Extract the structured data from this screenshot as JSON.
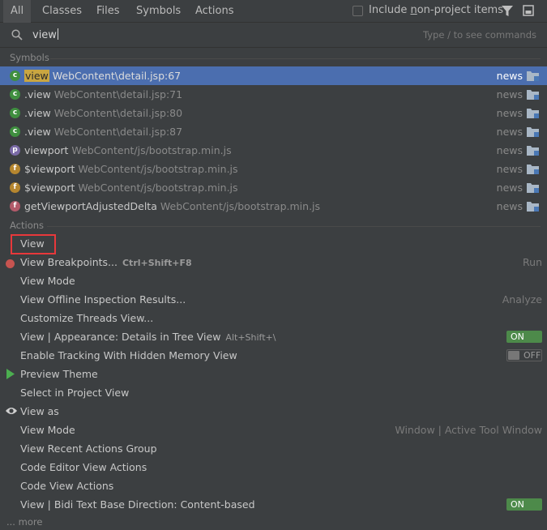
{
  "tabs": [
    "All",
    "Classes",
    "Files",
    "Symbols",
    "Actions"
  ],
  "include_non_project": {
    "label": "Include non-project items",
    "checked": false
  },
  "search": {
    "value": "view",
    "hint": "Type / to see commands"
  },
  "sections": {
    "symbols": "Symbols",
    "actions": "Actions"
  },
  "symbols": [
    {
      "icon": "c",
      "name_prefix": "",
      "name_match": "view",
      "name_suffix": "",
      "path": "WebContent\\detail.jsp:67",
      "location": "news",
      "selected": true
    },
    {
      "icon": "c",
      "name_prefix": "",
      "name_match": ".view",
      "name_suffix": "",
      "path": "WebContent\\detail.jsp:71",
      "location": "news",
      "selected": false
    },
    {
      "icon": "c",
      "name_prefix": "",
      "name_match": ".view",
      "name_suffix": "",
      "path": "WebContent\\detail.jsp:80",
      "location": "news",
      "selected": false
    },
    {
      "icon": "c",
      "name_prefix": "",
      "name_match": ".view",
      "name_suffix": "",
      "path": "WebContent\\detail.jsp:87",
      "location": "news",
      "selected": false
    },
    {
      "icon": "p",
      "name_prefix": "",
      "name_match": "viewport",
      "name_suffix": "",
      "path": "WebContent/js/bootstrap.min.js",
      "location": "news",
      "selected": false
    },
    {
      "icon": "f",
      "name_prefix": "",
      "name_match": "$viewport",
      "name_suffix": "",
      "path": "WebContent/js/bootstrap.min.js",
      "location": "news",
      "selected": false
    },
    {
      "icon": "f",
      "name_prefix": "",
      "name_match": "$viewport",
      "name_suffix": "",
      "path": "WebContent/js/bootstrap.min.js",
      "location": "news",
      "selected": false
    },
    {
      "icon": "f",
      "name_prefix": "",
      "name_match": "getViewportAdjustedDelta",
      "name_suffix": "",
      "path": "WebContent/js/bootstrap.min.js",
      "location": "news",
      "selected": false
    }
  ],
  "actions": [
    {
      "name": "View",
      "shortcut": "",
      "right": ""
    },
    {
      "name": "View Breakpoints...",
      "shortcut": "Ctrl+Shift+F8",
      "right": "Run"
    },
    {
      "name": "View Mode",
      "shortcut": "",
      "right": ""
    },
    {
      "name": "View Offline Inspection Results...",
      "shortcut": "",
      "right": "Analyze"
    },
    {
      "name": "Customize Threads View...",
      "shortcut": "",
      "right": ""
    },
    {
      "name": "View | Appearance: Details in Tree View",
      "shortcut": "Alt+Shift+\\",
      "toggle": "ON"
    },
    {
      "name": "Enable Tracking With Hidden Memory View",
      "shortcut": "",
      "toggle": "OFF"
    },
    {
      "name": "Preview Theme",
      "shortcut": "",
      "right": ""
    },
    {
      "name": "Select in Project View",
      "shortcut": "",
      "right": ""
    },
    {
      "name": "View as",
      "shortcut": "",
      "right": ""
    },
    {
      "name": "View Mode",
      "shortcut": "",
      "right": "Window | Active Tool Window"
    },
    {
      "name": "View Recent Actions Group",
      "shortcut": "",
      "right": ""
    },
    {
      "name": "Code Editor View Actions",
      "shortcut": "",
      "right": ""
    },
    {
      "name": "Code View Actions",
      "shortcut": "",
      "right": ""
    },
    {
      "name": "View | Bidi Text Base Direction: Content-based",
      "shortcut": "",
      "toggle": "ON"
    }
  ],
  "more": "... more",
  "colors": {
    "selection": "#4b6eaf",
    "match_highlight": "#c9a641",
    "toggle_on": "#4d8a4a",
    "annotation_box": "#e8383b"
  }
}
